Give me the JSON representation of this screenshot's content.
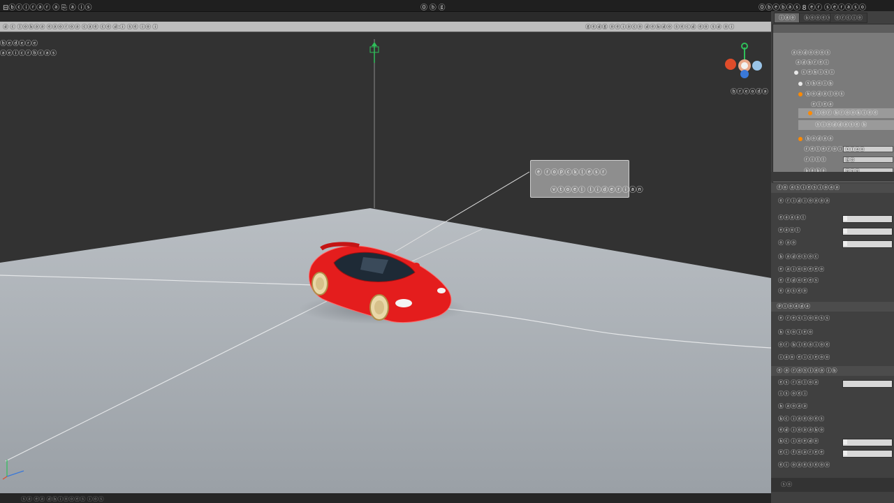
{
  "titlebar": {
    "left_text": "⊟ⓑⓒⓘⓡⓐⓡ ⓐ  ⎘ ⓐ ⓘⓢ",
    "center_text": "⓪ ⓑ ⓖ",
    "right_text": "⓪ⓑⓔⓑⓐⓢ 8 ⓔⓡ   ⓢⓔⓡⓐⓢⓞ"
  },
  "toolbar": {
    "left_text": "ⓓ ⓒ  ⓛⓞⓑⓐⓐ ⓔⓐⓞⓡⓞⓐ ⓒⓐⓔ  ⓒⓔ  ⓓ:ⓘ ⓢⓔ ⓘⓞ ⓘ",
    "right_text": "ⓖⓔⓓⓖ ⓞⓔⓘⓐⓒⓞ ⓓⓔⓑⓓⓞ ⓢⓔⓒⓓ ⓔⓞ  ⓢⓓ  ⓞⓘ"
  },
  "scene": {
    "label_a": "ⓑⓔⓓⓔⓡⓔ",
    "label_b": "ⓐⓔⓘⓒⓡⓑⓒⓐⓢ",
    "gizmo_label": "ⓑⓡⓔⓞⓓⓐ",
    "callout_title": "ⓔ ⓡⓞⓟⓒⓚⓛⓔⓢⓡ",
    "callout_sub": "ⓥⓣⓞⓔⓛ  ⓛⓘⓓⓔⓡⓘⓐⓝ",
    "colors": {
      "car": "#e41d1d",
      "ground": "#a4aab0",
      "sky": "#323232",
      "axis_green": "#2fbf5a",
      "axis_red": "#e04c2a",
      "axis_blue": "#3a78d8"
    }
  },
  "statusbar": {
    "text": "ⓢⓐ ⓔⓐ ⓓⓑⓘⓞⓞⓔⓢ ⓘⓞⓢ"
  },
  "right_panel": {
    "tabs": [
      "ⓘⓐⓞ",
      "ⓑⓞⓞⓔⓢ",
      "ⓔⓡⓒⓘⓞ"
    ],
    "hierarchy": [
      {
        "label": "ⓐⓞⓓⓞⓞⓞⓢ",
        "indent": 0,
        "dot": ""
      },
      {
        "label": "ⓐⓓⓑⓡⓔⓘ",
        "indent": 1,
        "dot": ""
      },
      {
        "label": "ⓒⓔⓑⓘⓢⓘ",
        "indent": 2,
        "dot": "#e8e8e8"
      },
      {
        "label": "ⓢⓑⓞⓘⓑ",
        "indent": 3,
        "dot": "#e8e8e8"
      },
      {
        "label": "ⓑⓞⓓⓐⓛⓞⓢ",
        "indent": 3,
        "dot": "#ff8a00"
      },
      {
        "label": "ⓔⓛⓔⓐ",
        "indent": 4,
        "dot": ""
      },
      {
        "label": "ⓘⓞⓡ ⓑⓡⓞⓞⓚⓘⓔⓔ",
        "indent": 4,
        "dot": "#ff8a00",
        "selected": true
      },
      {
        "label": "ⓢⓘⓞⓓⓓⓐⓢⓔ ⓑ",
        "indent": 4,
        "dot": "",
        "selected": true
      },
      {
        "label": "ⓑⓞⓓⓐⓐ",
        "indent": 3,
        "dot": "#ff8a00"
      }
    ],
    "hier_props": [
      {
        "label": "ⓡⓔⓛⓔⓡⓞⓘⓐ",
        "value": "ⓢⓛⓐⓞ"
      },
      {
        "label": "ⓡⓘⓛⓛ",
        "value": "ⓖⓞ"
      },
      {
        "label": "ⓑⓐⓑⓐ",
        "value": "ⓞⓔⓞ"
      }
    ],
    "section1": {
      "title": "ⓕⓞ ⓐⓢⓘⓔⓢⓘⓞⓐⓐ",
      "sub": "ⓔ ⓡⓘⓓⓘⓞⓐⓐⓐ",
      "rows": [
        "ⓔⓐⓐⓐⓛ",
        "ⓔⓐⓞⓛ",
        "ⓞ ⓐⓞ",
        "ⓑ ⓐⓓⓞⓢⓞⓒ",
        "ⓔ ⓐⓘⓞⓞⓔⓔⓞ",
        "ⓔ ⓕⓓⓞⓔⓔⓢ",
        "ⓔ ⓐⓢⓔⓞ"
      ]
    },
    "section2": {
      "title": "ⓟⓘⓞⓐⓓⓐ",
      "sub": "ⓔ ⓡⓔⓢⓘⓞⓞⓢⓢ",
      "rows": [
        "ⓑ ⓢⓞⓘⓔⓞ",
        "ⓞⓡ ⓑⓘⓔⓐⓘⓞⓔ",
        "ⓘⓐⓞ ⓔⓘⓒⓔⓞⓞ"
      ]
    },
    "section3": {
      "title": "ⓔ ⓐ ⓡⓐⓢⓘⓐⓐ ⓘⓑ",
      "rows": [
        "ⓔⓢ ⓡⓞⓛⓞⓐ",
        "ⓘⓢ ⓞⓔⓘ",
        "ⓑ ⓐⓞⓐⓐ",
        "ⓑⓒ ⓘⓐⓔⓞⓔⓢ",
        "ⓔⓓ ⓘⓞⓐⓐⓑⓞ",
        "ⓑⓒ ⓘⓞⓔⓓⓞ",
        "ⓔⓘ ⓕⓞⓐⓡⓔⓔ",
        "ⓔⓘ ⓞⓐⓔⓢⓔⓞⓞ"
      ]
    },
    "footer": "ⓢⓞ"
  }
}
